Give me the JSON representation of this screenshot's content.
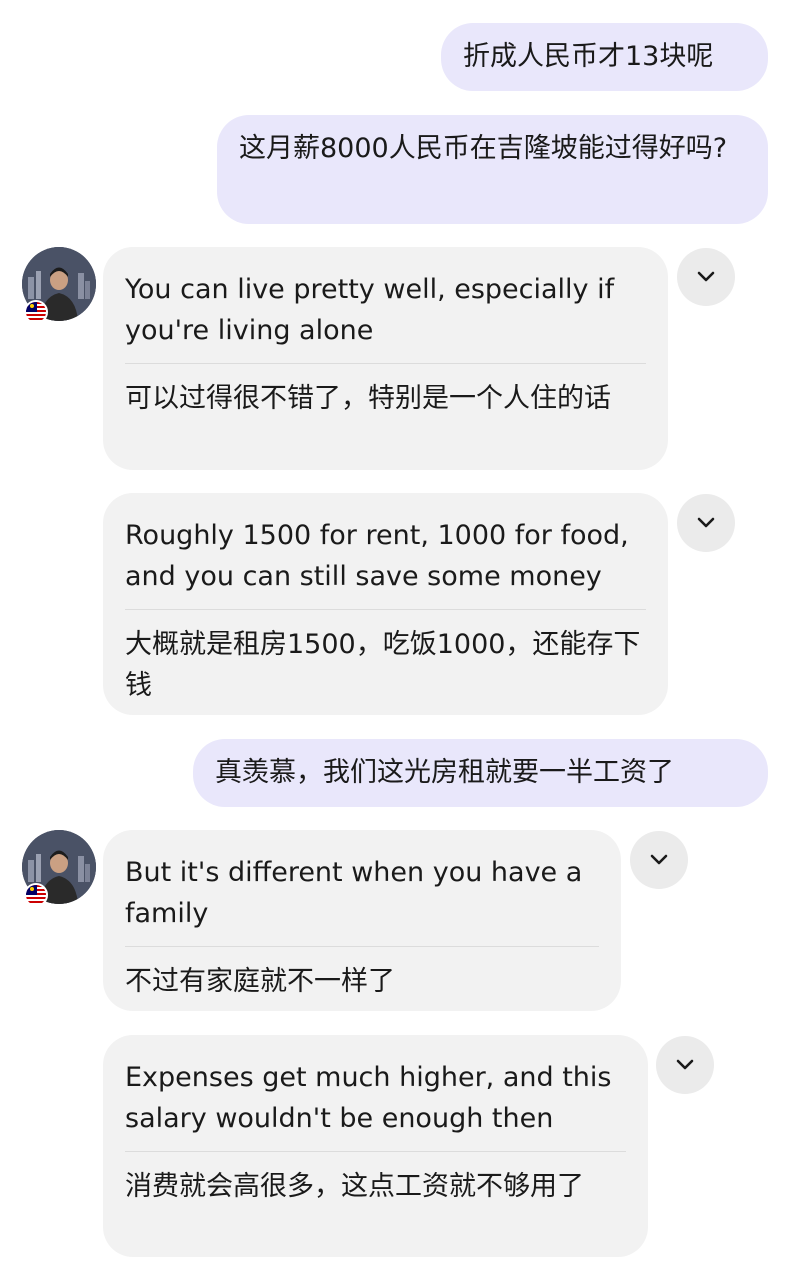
{
  "messages": [
    {
      "side": "out",
      "text": "折成人民币才13块呢"
    },
    {
      "side": "out",
      "text": "这月薪8000人民币在吉隆坡能过得好吗?"
    },
    {
      "side": "in",
      "en": "You can live pretty well, especially if you're living alone",
      "zh": "可以过得很不错了，特别是一个人住的话"
    },
    {
      "side": "in",
      "en": "Roughly 1500 for rent, 1000 for food, and you can still save some money",
      "zh": "大概就是租房1500，吃饭1000，还能存下钱"
    },
    {
      "side": "out",
      "text": "真羡慕，我们这光房租就要一半工资了"
    },
    {
      "side": "in",
      "en": "But it's different when you have a family",
      "zh": "不过有家庭就不一样了"
    },
    {
      "side": "in",
      "en": "Expenses get much higher, and this salary wouldn't be enough then",
      "zh": "消费就会高很多，这点工资就不够用了"
    }
  ],
  "icons": {
    "options": "chevron-down-icon",
    "avatar": "avatar",
    "flag": "malaysia-flag-icon"
  },
  "colors": {
    "outgoing_bubble": "#e9e7fb",
    "incoming_bubble": "#f2f2f2",
    "chevron_button": "#ebebeb"
  }
}
